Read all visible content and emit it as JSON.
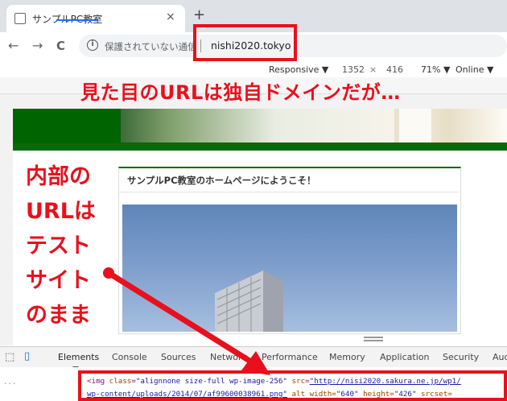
{
  "browser": {
    "tab_title": "サンプルPC教室",
    "tab_close": "×",
    "new_tab": "+",
    "nav_back": "←",
    "nav_forward": "→",
    "nav_reload": "C",
    "security_text": "保護されていない通信",
    "url": "nishi2020.tokyo"
  },
  "device_toolbar": {
    "mode": "Responsive ▼",
    "width": "1352",
    "times": "×",
    "height": "416",
    "zoom": "71% ▼",
    "network": "Online ▼"
  },
  "page": {
    "welcome_heading": "サンプルPC教室のホームページにようこそ！"
  },
  "devtools": {
    "tabs": [
      "Elements",
      "Console",
      "Sources",
      "Network",
      "Performance",
      "Memory",
      "Application",
      "Security",
      "Aud"
    ],
    "active_tab": "Elements",
    "code": {
      "line1_open": "<img ",
      "class_attr": "class",
      "class_val": "\"alignnone size-full wp-image-256\"",
      "src_attr": "src",
      "src_val": "\"http://nisi2020.sakura.ne.jp/wp1/",
      "line2_path": "wp-content/uploads/2014/07/af99600038961.png\"",
      "alt_attr": "alt",
      "width_attr": "width",
      "width_val": "\"640\"",
      "height_attr": "height",
      "height_val": "\"426\"",
      "srcset_attr": "srcset="
    }
  },
  "annotations": {
    "top": "見た目のURLは独自ドメインだが…",
    "left_lines": [
      "内部の",
      "URLは",
      "テスト",
      "サイト",
      "のまま"
    ],
    "color": "#e8101c"
  }
}
